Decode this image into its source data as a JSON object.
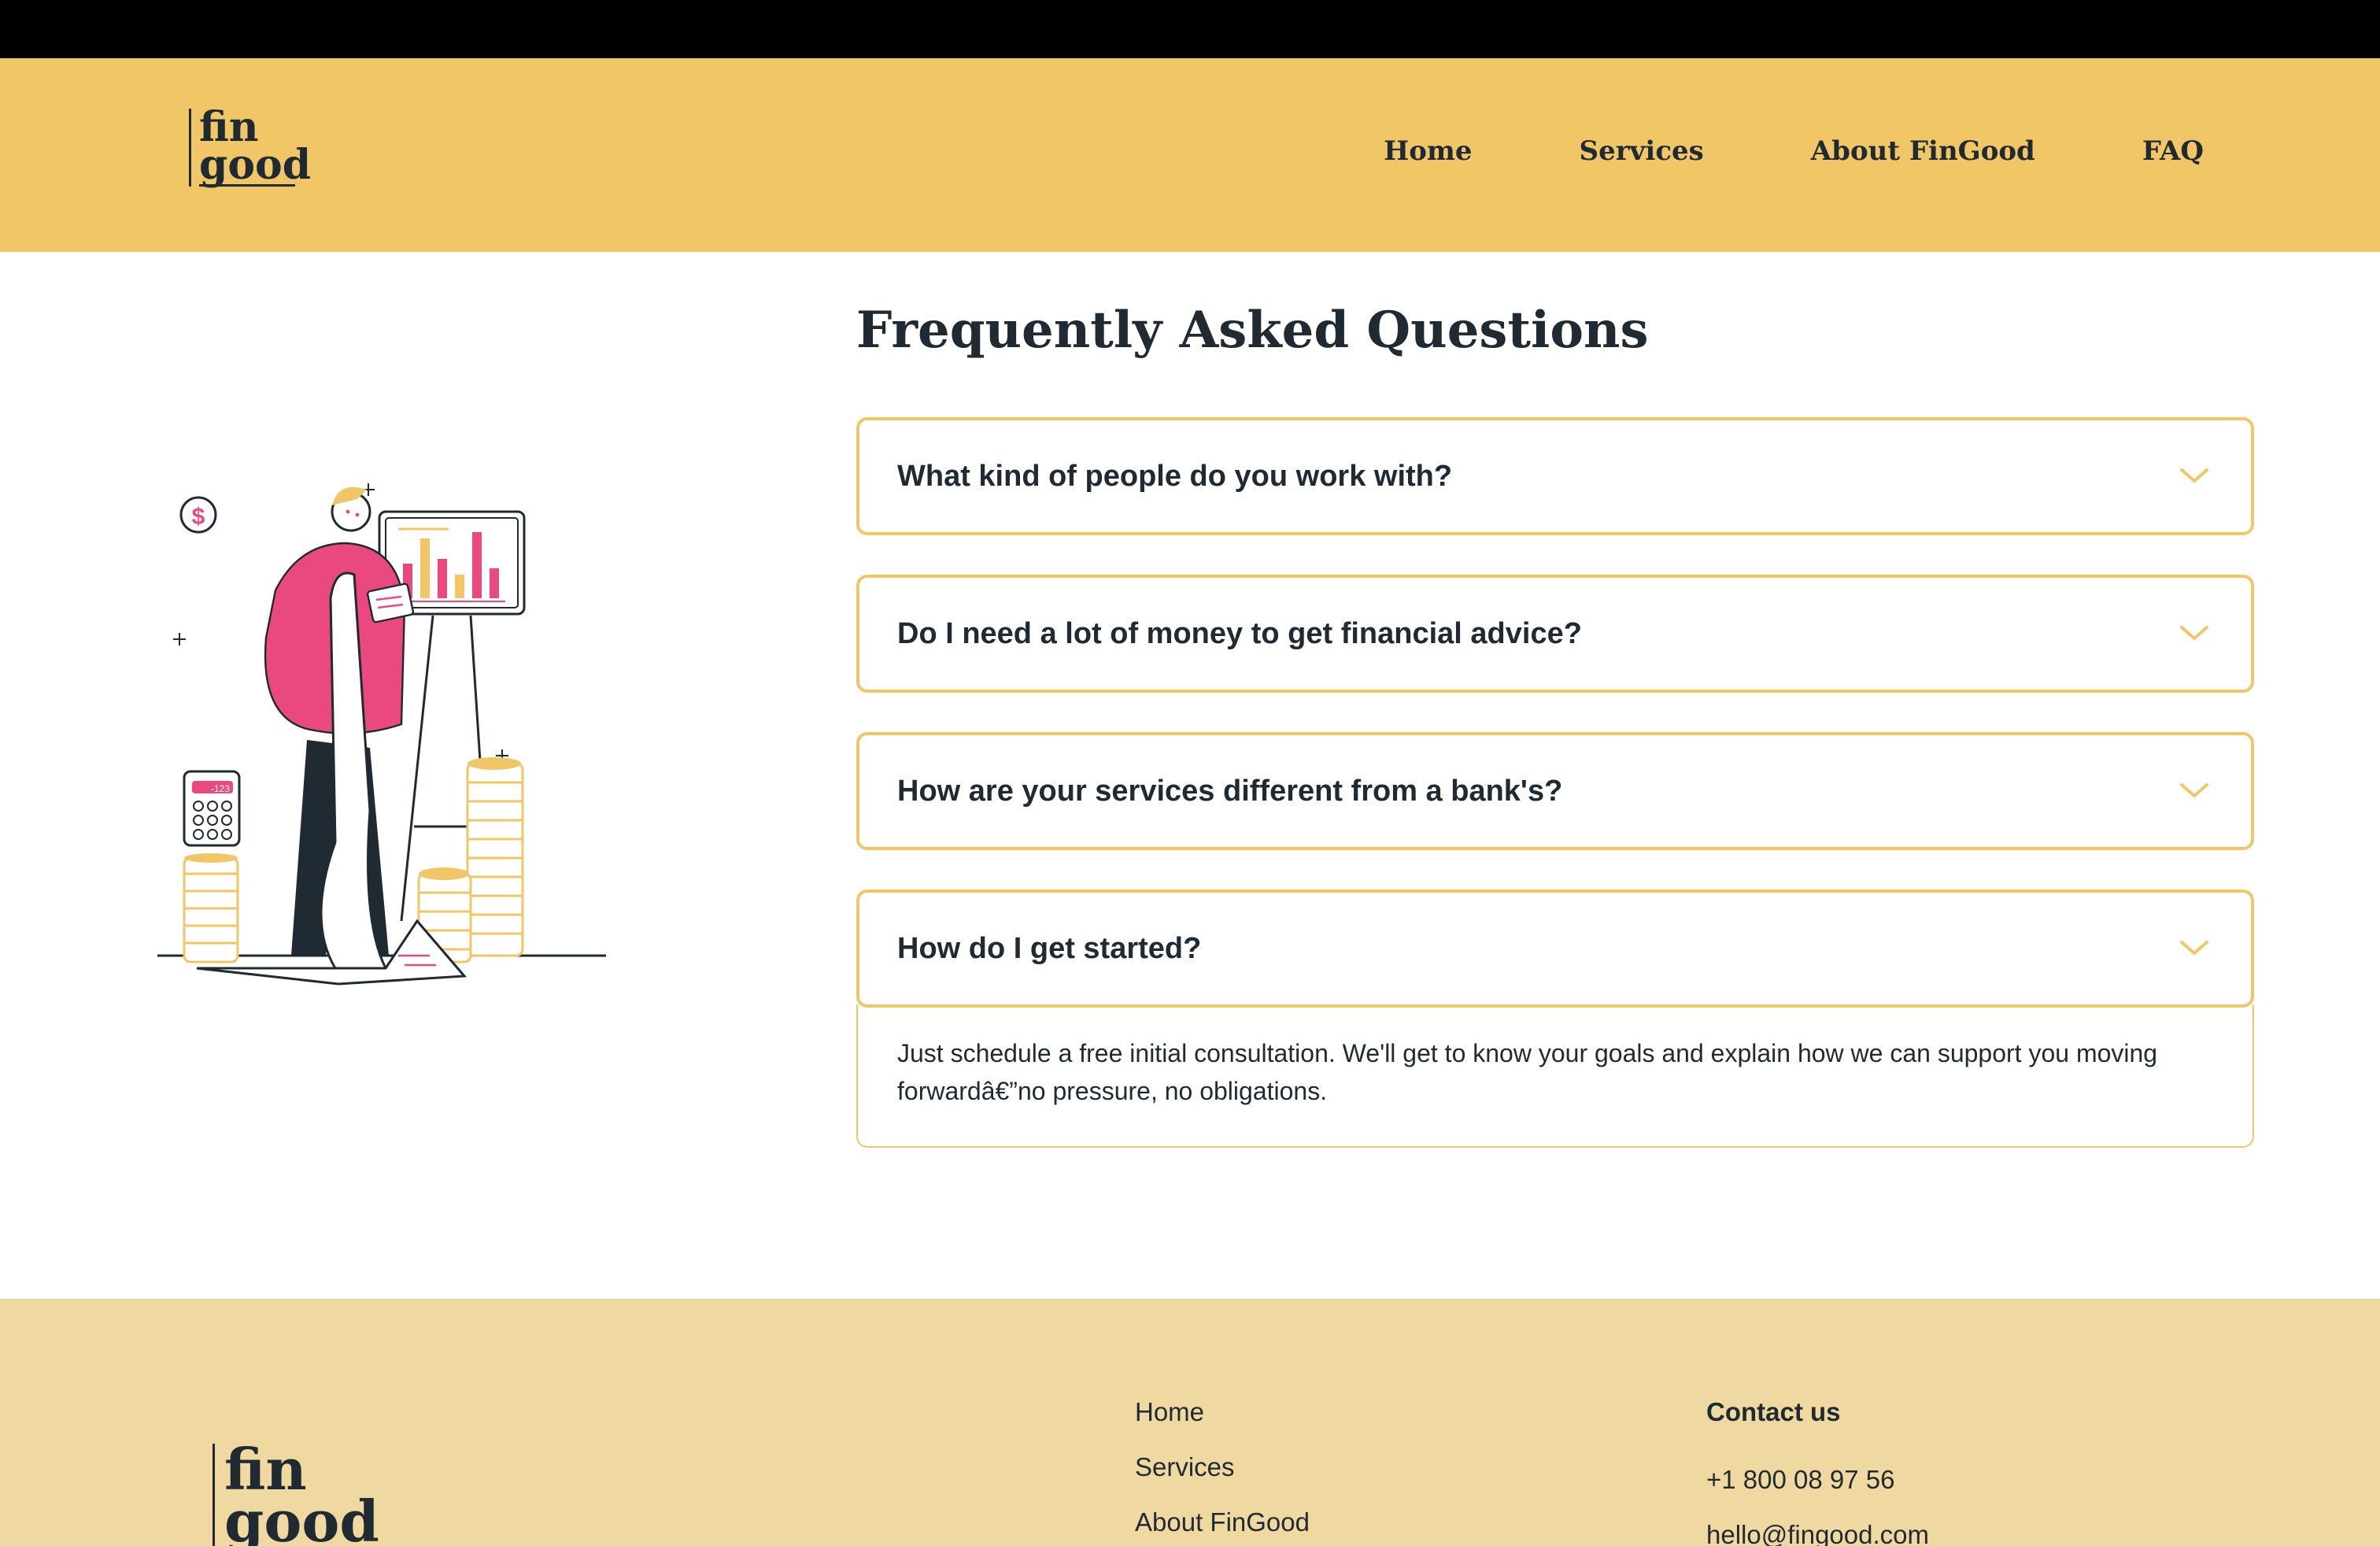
{
  "brand": {
    "logo_line1": "fin",
    "logo_line2": "good"
  },
  "nav": {
    "items": [
      "Home",
      "Services",
      "About FinGood",
      "FAQ"
    ]
  },
  "illustration": {
    "calculator_display": "-123",
    "speech_symbol": "$"
  },
  "faq": {
    "title": "Frequently Asked Questions",
    "items": [
      {
        "question": "What kind of people do you work with?",
        "expanded": false
      },
      {
        "question": "Do I need a lot of money to get financial advice?",
        "expanded": false
      },
      {
        "question": "How are your services different from a bank's?",
        "expanded": false
      },
      {
        "question": "How do I get started?",
        "expanded": true,
        "answer": "Just schedule a free initial consultation. We'll get to know your goals and explain how we can support you moving forwardâ€”no pressure, no obligations."
      }
    ]
  },
  "footer": {
    "links": [
      "Home",
      "Services",
      "About FinGood"
    ],
    "contact_title": "Contact us",
    "phone": "+1 800 08 97 56",
    "email": "hello@fingood.com"
  },
  "colors": {
    "header_bg": "#f1c666",
    "footer_bg": "#f0d9a0",
    "accent_pink": "#e9497f",
    "text_dark": "#1f2a33"
  },
  "icons": [
    "chevron-down-icon"
  ]
}
